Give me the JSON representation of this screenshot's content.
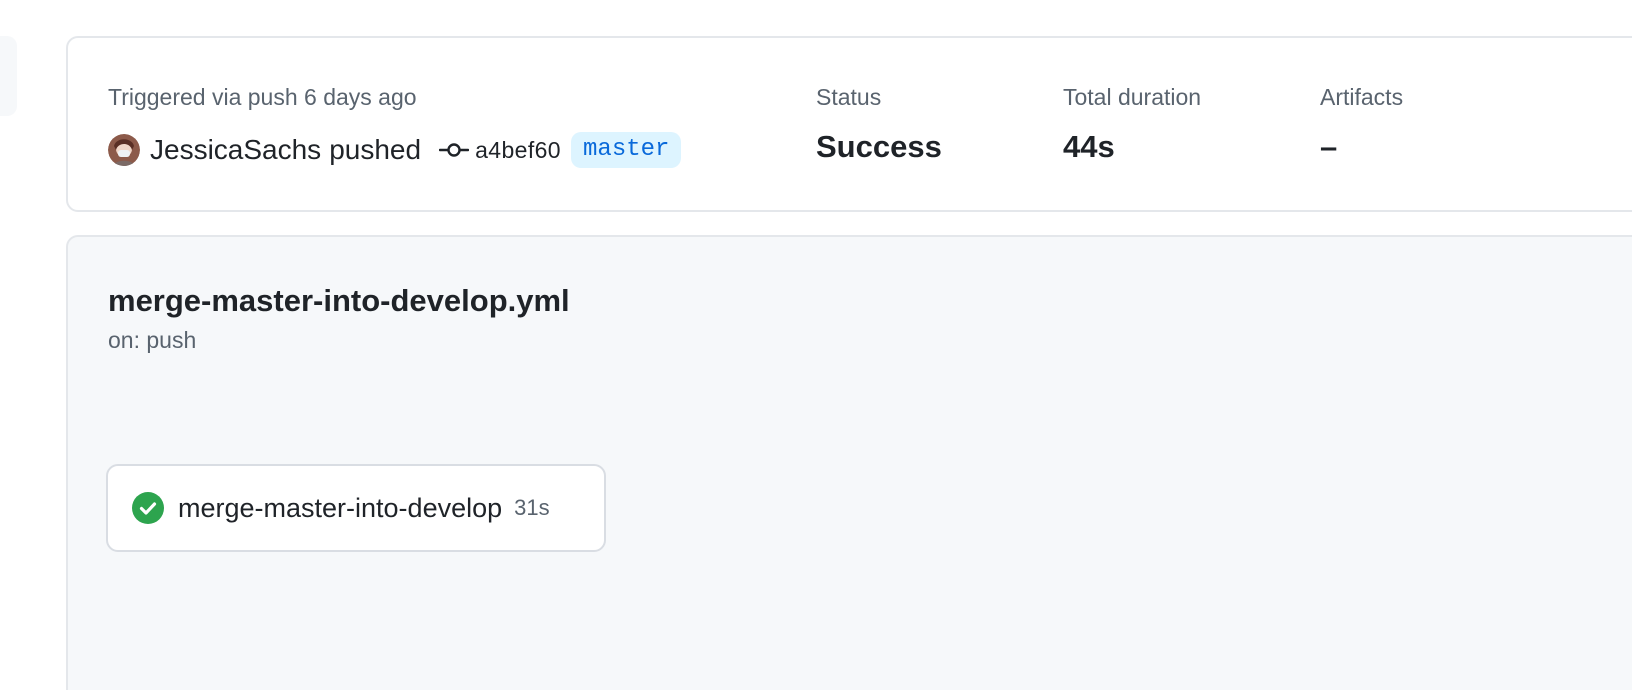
{
  "summary": {
    "trigger_text": "Triggered via push 6 days ago",
    "actor": "JessicaSachs",
    "action": "pushed",
    "commit_sha": "a4bef60",
    "branch": "master",
    "avatar_icon": "user-avatar",
    "commit_icon": "git-commit-icon",
    "stats": {
      "status_label": "Status",
      "status_value": "Success",
      "duration_label": "Total duration",
      "duration_value": "44s",
      "artifacts_label": "Artifacts",
      "artifacts_value": "–"
    }
  },
  "workflow": {
    "filename": "merge-master-into-develop.yml",
    "trigger": "on: push",
    "jobs": [
      {
        "name": "merge-master-into-develop",
        "duration": "31s",
        "status": "success",
        "status_icon": "check-circle-icon"
      }
    ]
  },
  "colors": {
    "success": "#2da44e",
    "branch_bg": "#ddf4ff",
    "branch_text": "#0969da",
    "muted_text": "#59636e",
    "card_bg": "#f6f8fa"
  }
}
